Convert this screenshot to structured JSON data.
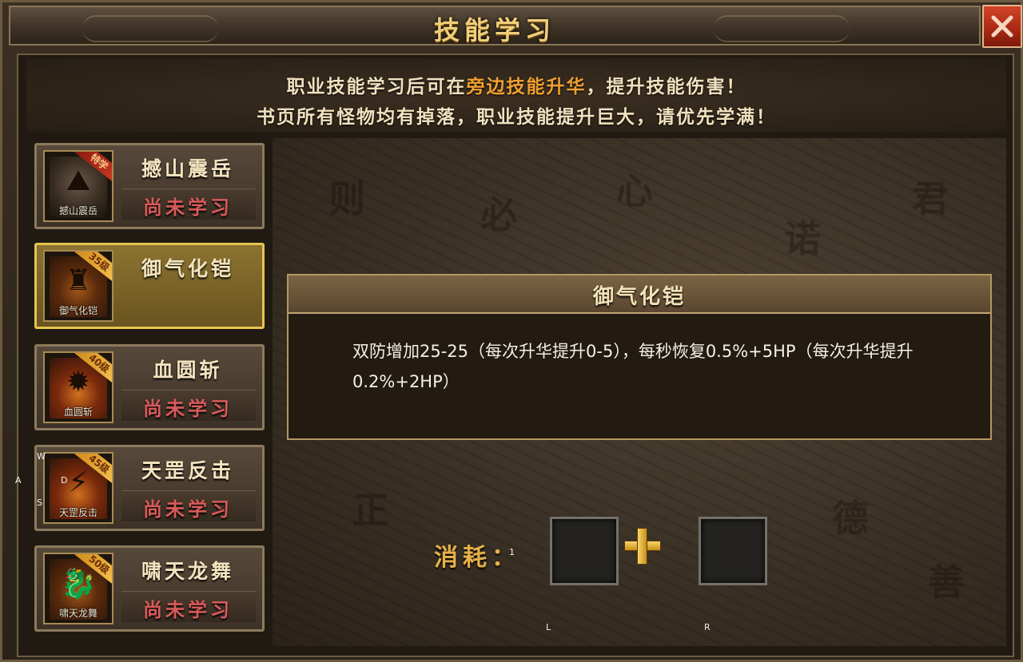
{
  "window": {
    "title": "技能学习",
    "close_icon": "close-x-icon"
  },
  "notice": {
    "line1_prefix": "职业技能学习后可在",
    "line1_highlight": "旁边技能升华",
    "line1_suffix": "，提升技能伤害！",
    "line2": "书页所有怪物均有掉落，职业技能提升巨大，请优先学满！",
    "highlight_color": "#f0a030"
  },
  "skills": [
    {
      "name": "撼山震岳",
      "icon_caption": "撼山震岳",
      "badge": "特学",
      "status": "尚未学习",
      "icon": "mountain-strike-icon"
    },
    {
      "name": "御气化铠",
      "icon_caption": "御气化铠",
      "badge": "35级",
      "status": "",
      "icon": "qi-armor-icon",
      "selected": true
    },
    {
      "name": "血圆斩",
      "icon_caption": "血圆斩",
      "badge": "40级",
      "status": "尚未学习",
      "icon": "blood-circle-slash-icon"
    },
    {
      "name": "天罡反击",
      "icon_caption": "天罡反击",
      "badge": "45级",
      "status": "尚未学习",
      "icon": "tiangang-counter-icon"
    },
    {
      "name": "啸天龙舞",
      "icon_caption": "啸天龙舞",
      "badge": "50级",
      "status": "尚未学习",
      "icon": "dragon-dance-icon"
    }
  ],
  "detail": {
    "title": "御气化铠",
    "description": "双防增加25-25（每次升华提升0-5），每秒恢复0.5%+5HP（每次升华提升0.2%+2HP）"
  },
  "cost": {
    "label": "消耗：",
    "plus_icon": "plus-icon",
    "slot_left_hint": "L",
    "slot_right_hint": "R",
    "slot_count_hint": "1"
  },
  "key_hints": {
    "w": "W",
    "a": "A",
    "s": "S",
    "d": "D"
  },
  "colors": {
    "accent_gold": "#f0cf7a",
    "selected_border": "#e6c451",
    "status_red": "#d85a5a",
    "close_red": "#b22f18"
  }
}
